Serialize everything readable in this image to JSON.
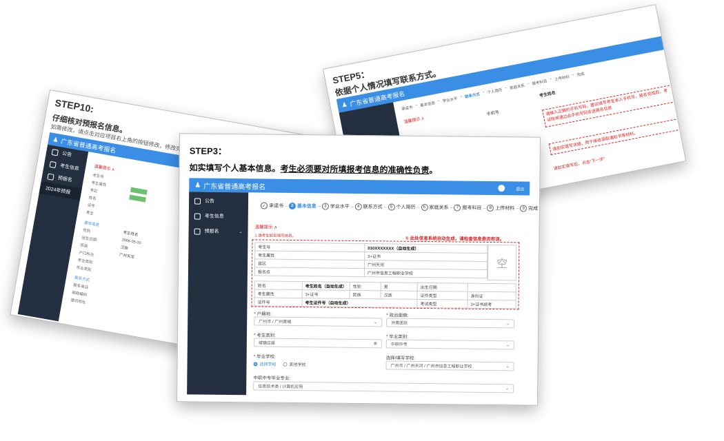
{
  "app": {
    "title": "广东省普通高考报名",
    "exit": "退出"
  },
  "step10": {
    "heading": "STEP10:",
    "subheading": "仔细核对预报名信息。",
    "note": "如需修改，请点击对应项目右上角的按钮修改，修改完",
    "nav": [
      "公告",
      "考生信息",
      "预报名",
      "2024年预报"
    ],
    "warn": "温馨提示 ∧",
    "fields": [
      "考生号",
      "考生属性",
      "考区",
      "姓名",
      "证件",
      "考生",
      "基本信息",
      "性别",
      "出生日期",
      "民族",
      "户口所在",
      "考生类别",
      "毕业类别",
      "联系方式",
      "联系电话",
      "邮政编码",
      "通讯地址"
    ],
    "values": [
      "考生姓名",
      "2006-05-20",
      "汉族",
      "广州天河"
    ]
  },
  "step5": {
    "heading": "STEP5：",
    "subheading": "依据个人情况填写联系方式。",
    "steps": [
      "承诺书",
      "基本信息",
      "学业水平",
      "联系方式",
      "个人简历",
      "家庭关系",
      "报考科目",
      "上传材料",
      "完成"
    ],
    "warn": "温馨提示 ∧",
    "labels": [
      "考生姓名",
      "手机号"
    ],
    "notes": [
      "请输入正确的手机号码，建议填写考生本人手机号，报名完成后，考试院将通过此手机号码发送报名信息",
      "请如实填写详细，用于接收录取通知书等材料。",
      "请如实填写后，点击“下一步”"
    ]
  },
  "step3": {
    "heading": "STEP3：",
    "subheading_plain": "如实填写个人基本信息。",
    "subheading_underline": "考生必须要对所填报考信息的准确性负责",
    "subheading_end": "。",
    "nav": [
      "公告",
      "考生信息",
      "预报名"
    ],
    "steps": [
      {
        "num": "✓",
        "label": "承诺书",
        "state": "done"
      },
      {
        "num": "2",
        "label": "基本信息",
        "state": "active"
      },
      {
        "num": "3",
        "label": "学业水平",
        "state": "todo"
      },
      {
        "num": "4",
        "label": "联系方式",
        "state": "todo"
      },
      {
        "num": "5",
        "label": "个人简历",
        "state": "todo"
      },
      {
        "num": "6",
        "label": "家庭关系",
        "state": "todo"
      },
      {
        "num": "7",
        "label": "报考科目",
        "state": "todo"
      },
      {
        "num": "8",
        "label": "上传材料",
        "state": "todo"
      },
      {
        "num": "9",
        "label": "完成",
        "state": "todo"
      }
    ],
    "warn_title": "温馨提示 ∧",
    "warn_text": "1.请考生如实填写信息。",
    "annotation": "① 此处信息系统自动生成，请检查信息是否有误。",
    "photo": "空",
    "info_rows": [
      {
        "label": "考生号",
        "value": "010XXXXXXX（自动生成）"
      },
      {
        "label": "考生属性",
        "value": "3+证书"
      },
      {
        "label": "县区",
        "value": "广州天河"
      },
      {
        "label": "报名点",
        "value": "广州市信息工程职业学校"
      }
    ],
    "person": {
      "name_label": "姓名",
      "name_value": "考生姓名（自动生成）",
      "gender_label": "性别",
      "gender_value": "男",
      "birth_label": "出生日期",
      "birth_value": "",
      "attr_label": "考生属性",
      "attr_value": "3+证书",
      "nation_label": "民族",
      "nation_value": "汉族",
      "idtype_label": "证件类型",
      "idtype_value": "身份证",
      "idno_label": "证件号",
      "idno_value": "考生证件号（自动生成）",
      "exam_label": "考试类型",
      "exam_value": "3+证书统考"
    },
    "form": {
      "hukou_label": "* 户籍地:",
      "hukou_value": "广州市 / 广州黄埔",
      "politics_label": "* 政治面貌:",
      "politics_value": "共青团员",
      "category_label": "* 考生类别:",
      "category_value": "城镇应届",
      "grad_label": "* 毕业类别:",
      "grad_value": "中职中专",
      "school_label": "* 毕业学校:",
      "school_opt1": "选择学校",
      "school_opt2": "其他学校",
      "pick_label": "选择/填写学校:",
      "pick_value": "广州市 / 广州天河 / 广州市信息工程职业学校",
      "major_label": "中职中专毕业专业:",
      "major_value": "信息技术类 / 计算机应用"
    }
  }
}
